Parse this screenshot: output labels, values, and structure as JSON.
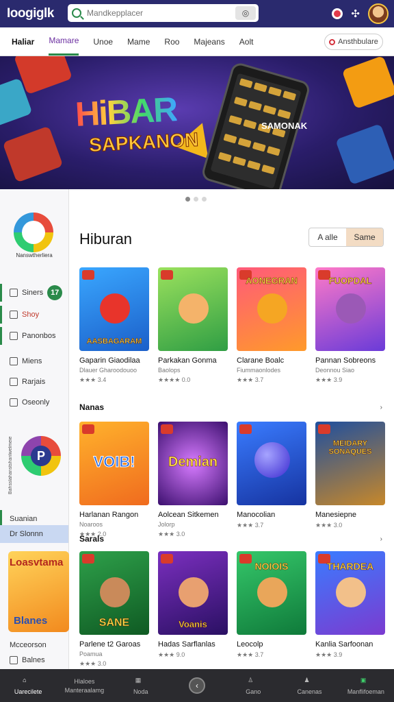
{
  "header": {
    "logo": "Ioogiglk",
    "search_placeholder": "Mandkepplacer",
    "mic_icon": "camera-search-icon"
  },
  "tabs": [
    "Haliar",
    "Mamare",
    "Unoe",
    "Mame",
    "Roo",
    "Majeans",
    "Aolt"
  ],
  "tab_button": "Ansthbulare",
  "banner": {
    "title": "HiBAR",
    "subtitle": "SAPKANON",
    "phone_label": "SAMONAK"
  },
  "sidebar": {
    "logo_caption": "Nanswtherliera",
    "items": [
      {
        "label": "Siners",
        "badge": "17"
      },
      {
        "label": "Shoy"
      },
      {
        "label": "Panonbos"
      },
      {
        "label": "Miens"
      },
      {
        "label": "Rarjais"
      },
      {
        "label": "Oseonly"
      }
    ],
    "vertical_text": "Bahsslahanstshanlwelmeie",
    "p_badge": "P",
    "lower_items": [
      {
        "label": "Suanian"
      },
      {
        "label": "Dr Slonnn"
      }
    ],
    "promo_top": "Loasvtama",
    "promo_bottom": "Blanes",
    "bottom_items": [
      {
        "label": "Mcceorson"
      },
      {
        "label": "Balnes"
      }
    ]
  },
  "main": {
    "title": "Hiburan",
    "segments": [
      "A alle",
      "Same"
    ],
    "row1": [
      {
        "art": "AASBAGARAM",
        "name": "Gaparin Giaodilaa",
        "sub": "Dlauer Gharoodouoo",
        "rating": "★★★ 3.4"
      },
      {
        "art": "",
        "name": "Parkakan Gonma",
        "sub": "Baolops",
        "rating": "★★★★ 0.0"
      },
      {
        "art": "AONEGRAN",
        "name": "Clarane Boalc",
        "sub": "Fiummaonlodes",
        "rating": "★★★ 3.7"
      },
      {
        "art": "FUOPDAL",
        "name": "Pannan Sobreons",
        "sub": "Deonnou Siao",
        "rating": "★★★ 3.9"
      }
    ],
    "section2": "Nanas",
    "row2": [
      {
        "art": "VOIB!",
        "name": "Harlanan Rangon",
        "sub": "Noaroos",
        "rating": "★★★ 2.0"
      },
      {
        "art": "Demian",
        "name": "Aolcean Sitkemen",
        "sub": "Jolorp",
        "rating": "★★★ 3.0"
      },
      {
        "art": "",
        "name": "Manocolian",
        "sub": "",
        "rating": "★★★ 3.7"
      },
      {
        "art": "MEIDARY SONAQUES",
        "name": "Manesiepne",
        "sub": "",
        "rating": "★★★ 3.0"
      }
    ],
    "section3": "Sarals",
    "row3": [
      {
        "art": "SANE",
        "name": "Parlene t2 Garoas",
        "sub": "Poamua",
        "rating": "★★★ 3.0"
      },
      {
        "art": "Voanis",
        "name": "Hadas Sarflanlas",
        "sub": "",
        "rating": "★★★ 9.0"
      },
      {
        "art": "NOIOIS",
        "name": "Leocolp",
        "sub": "",
        "rating": "★★★ 3.7"
      },
      {
        "art": "THARDEA",
        "name": "Kanlia Sarfoonan",
        "sub": "",
        "rating": "★★★ 3.9"
      }
    ]
  },
  "bottom_nav": [
    "Uarecilete",
    "Manteraalamg",
    "Noda",
    "",
    "Gano",
    "Canenas",
    "Manflifoeman"
  ],
  "bottom_nav_top": [
    "",
    "Hlaloes",
    "",
    "",
    "",
    "",
    ""
  ],
  "colors": {
    "header_bg": "#2a2a6e",
    "accent_green": "#2a8a4a",
    "accent_purple": "#6b2fa0",
    "nav_bg": "#2b2b2f"
  }
}
